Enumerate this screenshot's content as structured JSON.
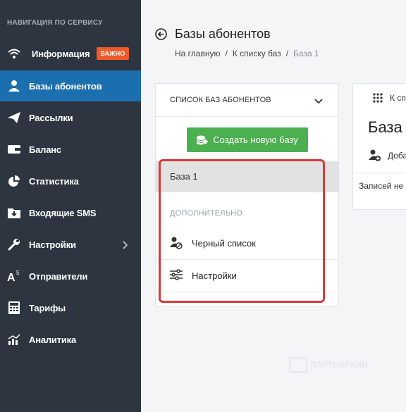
{
  "sidebar": {
    "heading": "НАВИГАЦИЯ ПО СЕРВИСУ",
    "items": [
      {
        "label": "Информация",
        "icon": "wifi-icon",
        "badge": "ВАЖНО"
      },
      {
        "label": "Базы абонентов",
        "icon": "user-icon",
        "active": true
      },
      {
        "label": "Рассылки",
        "icon": "send-icon"
      },
      {
        "label": "Баланс",
        "icon": "wallet-icon"
      },
      {
        "label": "Статистика",
        "icon": "pie-chart-icon"
      },
      {
        "label": "Входящие SMS",
        "icon": "inbox-icon"
      },
      {
        "label": "Настройки",
        "icon": "wrench-icon",
        "has_submenu": true
      },
      {
        "label": "Отправители",
        "icon": "sender-icon"
      },
      {
        "label": "Тарифы",
        "icon": "calculator-icon"
      },
      {
        "label": "Аналитика",
        "icon": "analytics-icon"
      }
    ]
  },
  "header": {
    "title": "Базы абонентов",
    "breadcrumb": [
      {
        "label": "На главную"
      },
      {
        "label": "К списку баз"
      },
      {
        "label": "База 1"
      }
    ],
    "separator": "/"
  },
  "list_panel": {
    "title": "СПИСОК БАЗ АБОНЕНТОВ",
    "create_button": "Создать новую базу",
    "bases": [
      "База 1"
    ],
    "extra_heading": "ДОПОЛНИТЕЛЬНО",
    "extra_items": [
      {
        "label": "Черный список",
        "icon": "blacklist-user-icon"
      },
      {
        "label": "Настройки",
        "icon": "sliders-icon"
      }
    ]
  },
  "detail_panel": {
    "small_label": "К сп",
    "title": "База",
    "add_label": "Доба",
    "records_text": "Записей не"
  },
  "watermark": "ПАРТНЕРКИН",
  "colors": {
    "sidebar_bg": "#2d3540",
    "active_bg": "#1b6fae",
    "badge": "#f05a28",
    "create_button": "#4caf50",
    "highlight": "#d63a3a"
  }
}
